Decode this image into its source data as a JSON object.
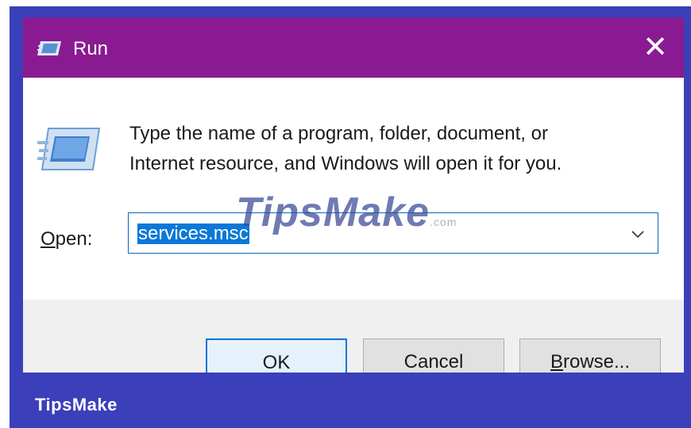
{
  "window": {
    "title": "Run",
    "close_glyph": "✕"
  },
  "icons": {
    "title": "run-icon",
    "main": "run-icon-large",
    "dropdown": "chevron-down-icon"
  },
  "description": {
    "line1": "Type the name of a program, folder, document, or",
    "line2": "Internet resource, and Windows will open it for you."
  },
  "open": {
    "label_accel": "O",
    "label_rest": "pen:",
    "value": "services.msc"
  },
  "buttons": {
    "ok": "OK",
    "cancel": "Cancel",
    "browse_accel": "B",
    "browse_rest": "rowse..."
  },
  "watermark": {
    "text": "TipsMake",
    "suffix": ".com"
  },
  "brand": {
    "text": "TipsMake"
  },
  "colors": {
    "titlebar": "#8a1a91",
    "frame": "#3b3fba",
    "selection": "#0a78d7",
    "focus_border": "#0a66c2"
  }
}
